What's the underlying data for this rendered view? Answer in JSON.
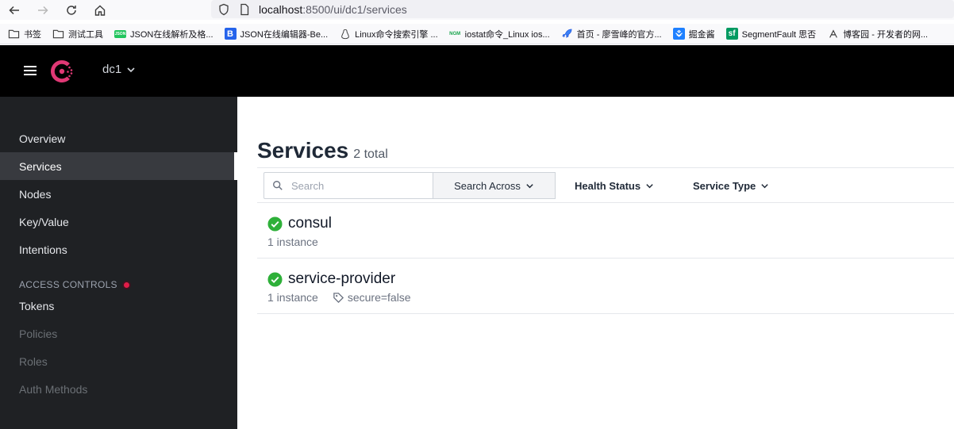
{
  "browser": {
    "url_host": "localhost",
    "url_path": ":8500/ui/dc1/services"
  },
  "bookmarks": [
    {
      "label": "书签",
      "icon": "folder-icon"
    },
    {
      "label": "测试工具",
      "icon": "folder-icon"
    },
    {
      "label": "JSON在线解析及格...",
      "icon": "json-site-icon"
    },
    {
      "label": "JSON在线编辑器-Be...",
      "icon": "b-site-icon"
    },
    {
      "label": "Linux命令搜索引擎 ...",
      "icon": "linux-penguin-icon"
    },
    {
      "label": "iostat命令_Linux ios...",
      "icon": "ngm-site-icon"
    },
    {
      "label": "首页 - 廖雪峰的官方...",
      "icon": "rocket-icon"
    },
    {
      "label": "掘金酱",
      "icon": "juejin-icon"
    },
    {
      "label": "SegmentFault 思否",
      "icon": "sf-icon"
    },
    {
      "label": "博客园 - 开发者的网...",
      "icon": "cnblogs-icon"
    }
  ],
  "header": {
    "datacenter": "dc1"
  },
  "sidebar": {
    "items": [
      {
        "label": "Overview"
      },
      {
        "label": "Services"
      },
      {
        "label": "Nodes"
      },
      {
        "label": "Key/Value"
      },
      {
        "label": "Intentions"
      }
    ],
    "section_label": "ACCESS CONTROLS",
    "acl_items": [
      {
        "label": "Tokens"
      },
      {
        "label": "Policies"
      },
      {
        "label": "Roles"
      },
      {
        "label": "Auth Methods"
      }
    ]
  },
  "main": {
    "title": "Services",
    "count": "2 total",
    "search_placeholder": "Search",
    "search_across": "Search Across",
    "health_status": "Health Status",
    "service_type": "Service Type",
    "services": [
      {
        "name": "consul",
        "instances": "1 instance",
        "tag": ""
      },
      {
        "name": "service-provider",
        "instances": "1 instance",
        "tag": "secure=false"
      }
    ]
  },
  "colors": {
    "header_bg": "#000000",
    "sidebar_bg": "#1f2124",
    "brand": "#e03875",
    "healthy": "#2eb039"
  }
}
